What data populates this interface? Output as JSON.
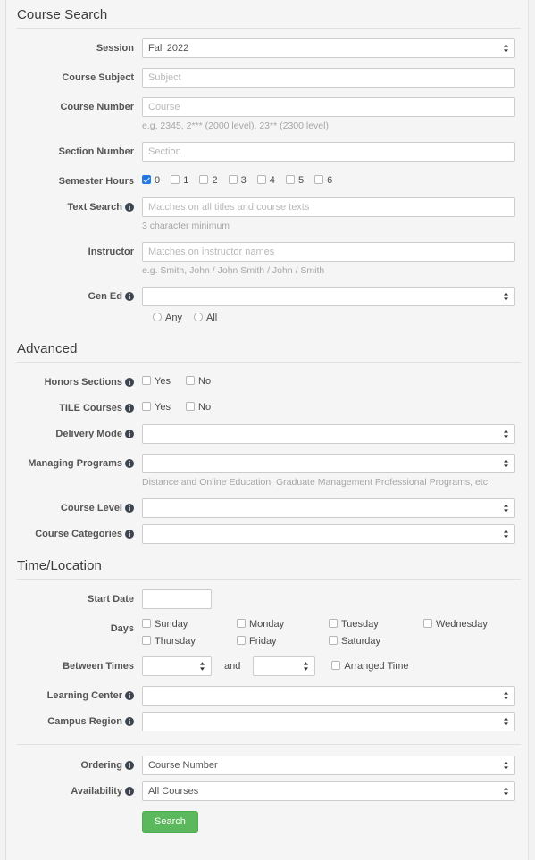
{
  "sections": {
    "course_search": {
      "title": "Course Search",
      "fields": {
        "session": {
          "label": "Session",
          "value": "Fall 2022"
        },
        "course_subject": {
          "label": "Course Subject",
          "placeholder": "Subject",
          "value": ""
        },
        "course_number": {
          "label": "Course Number",
          "placeholder": "Course",
          "value": "",
          "hint": "e.g. 2345, 2*** (2000 level), 23** (2300 level)"
        },
        "section_number": {
          "label": "Section Number",
          "placeholder": "Section",
          "value": ""
        },
        "semester_hours": {
          "label": "Semester Hours",
          "options": [
            {
              "label": "0",
              "checked": true
            },
            {
              "label": "1",
              "checked": false
            },
            {
              "label": "2",
              "checked": false
            },
            {
              "label": "3",
              "checked": false
            },
            {
              "label": "4",
              "checked": false
            },
            {
              "label": "5",
              "checked": false
            },
            {
              "label": "6",
              "checked": false
            }
          ]
        },
        "text_search": {
          "label": "Text Search",
          "placeholder": "Matches on all titles and course texts",
          "value": "",
          "hint": "3 character minimum",
          "has_info": true
        },
        "instructor": {
          "label": "Instructor",
          "placeholder": "Matches on instructor names",
          "value": "",
          "hint": "e.g. Smith, John / John Smith / John / Smith"
        },
        "gen_ed": {
          "label": "Gen Ed",
          "value": "",
          "has_info": true,
          "radios": [
            {
              "label": "Any",
              "selected": false
            },
            {
              "label": "All",
              "selected": false
            }
          ]
        }
      }
    },
    "advanced": {
      "title": "Advanced",
      "fields": {
        "honors_sections": {
          "label": "Honors Sections",
          "has_info": true,
          "options": [
            {
              "label": "Yes",
              "checked": false
            },
            {
              "label": "No",
              "checked": false
            }
          ]
        },
        "tile_courses": {
          "label": "TILE Courses",
          "has_info": true,
          "options": [
            {
              "label": "Yes",
              "checked": false
            },
            {
              "label": "No",
              "checked": false
            }
          ]
        },
        "delivery_mode": {
          "label": "Delivery Mode",
          "value": "",
          "has_info": true
        },
        "managing_programs": {
          "label": "Managing Programs",
          "value": "",
          "has_info": true,
          "hint": "Distance and Online Education, Graduate Management Professional Programs, etc."
        },
        "course_level": {
          "label": "Course Level",
          "value": "",
          "has_info": true
        },
        "course_categories": {
          "label": "Course Categories",
          "value": "",
          "has_info": true
        }
      }
    },
    "time_location": {
      "title": "Time/Location",
      "fields": {
        "start_date": {
          "label": "Start Date",
          "value": ""
        },
        "days": {
          "label": "Days",
          "options": [
            {
              "label": "Sunday",
              "checked": false
            },
            {
              "label": "Monday",
              "checked": false
            },
            {
              "label": "Tuesday",
              "checked": false
            },
            {
              "label": "Wednesday",
              "checked": false
            },
            {
              "label": "Thursday",
              "checked": false
            },
            {
              "label": "Friday",
              "checked": false
            },
            {
              "label": "Saturday",
              "checked": false
            }
          ]
        },
        "between_times": {
          "label": "Between Times",
          "from_value": "",
          "conjunction": "and",
          "to_value": "",
          "arranged_time": {
            "label": "Arranged Time",
            "checked": false
          }
        },
        "learning_center": {
          "label": "Learning Center",
          "value": "",
          "has_info": true
        },
        "campus_region": {
          "label": "Campus Region",
          "value": "",
          "has_info": true
        }
      }
    },
    "footer": {
      "fields": {
        "ordering": {
          "label": "Ordering",
          "value": "Course Number",
          "has_info": true
        },
        "availability": {
          "label": "Availability",
          "value": "All Courses",
          "has_info": true
        }
      },
      "search_button": "Search"
    }
  },
  "icons": {
    "info": "info-circle-icon",
    "select_caret": "select-updown-caret-icon"
  },
  "colors": {
    "page_background": "#f2f2f2",
    "panel_background": "#f5f5f5",
    "label_text": "#555555",
    "hint_text": "#a6a6a6",
    "checkbox_checked": "#2379e3",
    "search_button": "#5cb85c",
    "border": "#cccccc"
  }
}
